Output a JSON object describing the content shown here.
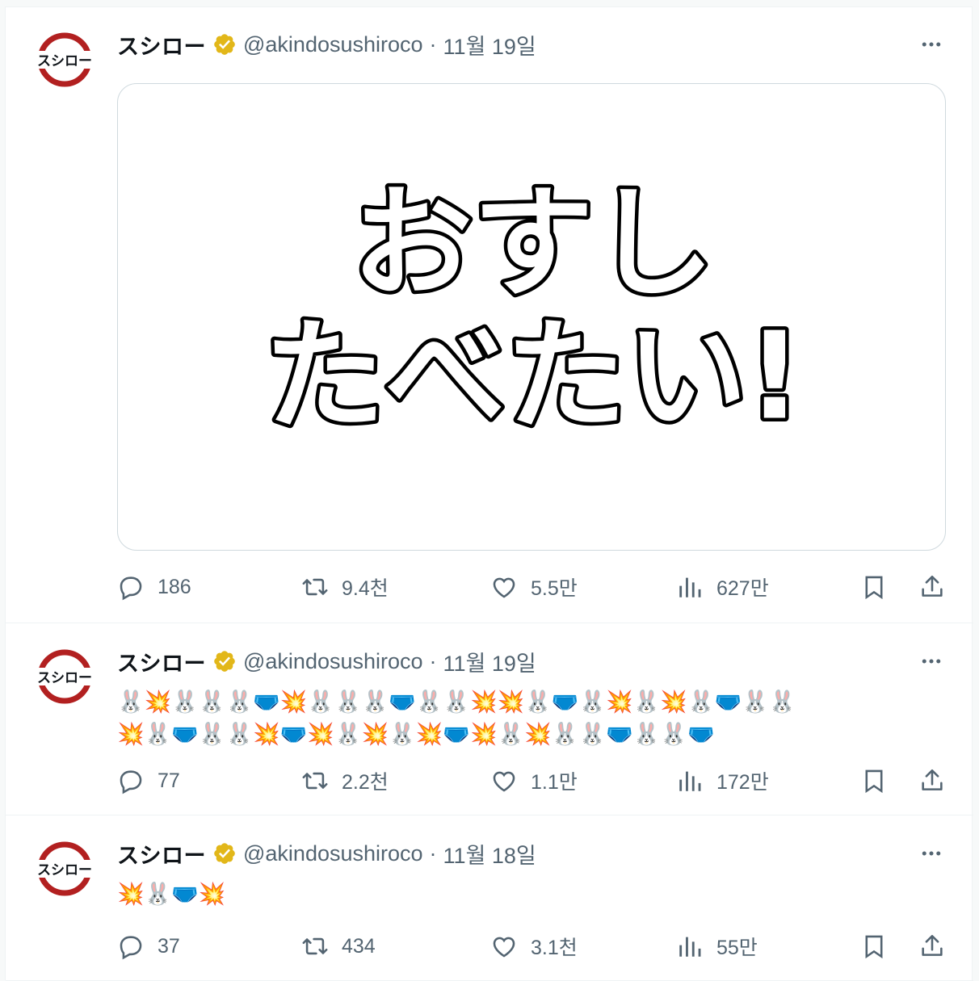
{
  "colors": {
    "text": "#0f1419",
    "secondary": "#536471",
    "border": "#cfd9de",
    "verified": "#e2b719",
    "logo_red": "#b22020"
  },
  "tweets": [
    {
      "name": "スシロー",
      "handle": "@akindosushiroco",
      "separator": "·",
      "date": "11월 19일",
      "media_text": [
        "おすし",
        "たべたい!"
      ],
      "emoji_lines": [],
      "stats": {
        "replies": "186",
        "retweets": "9.4천",
        "likes": "5.5만",
        "views": "627만"
      }
    },
    {
      "name": "スシロー",
      "handle": "@akindosushiroco",
      "separator": "·",
      "date": "11월 19일",
      "emoji_lines": [
        "🐰💥🐰🐰🐰🩲💥🐰🐰🐰🩲🐰🐰💥💥🐰🩲🐰💥🐰💥🐰🩲🐰🐰",
        "💥🐰🩲🐰🐰💥🩲💥🐰💥🐰💥🩲💥🐰💥🐰🐰🩲🐰🐰🩲"
      ],
      "stats": {
        "replies": "77",
        "retweets": "2.2천",
        "likes": "1.1만",
        "views": "172만"
      }
    },
    {
      "name": "スシロー",
      "handle": "@akindosushiroco",
      "separator": "·",
      "date": "11월 18일",
      "emoji_lines": [
        "💥🐰🩲💥"
      ],
      "stats": {
        "replies": "37",
        "retweets": "434",
        "likes": "3.1천",
        "views": "55만"
      }
    }
  ],
  "avatar_logo_text": "スシロー",
  "icons": [
    "reply-icon",
    "retweet-icon",
    "like-icon",
    "views-icon",
    "bookmark-icon",
    "share-icon",
    "more-icon",
    "verified-badge-icon"
  ]
}
